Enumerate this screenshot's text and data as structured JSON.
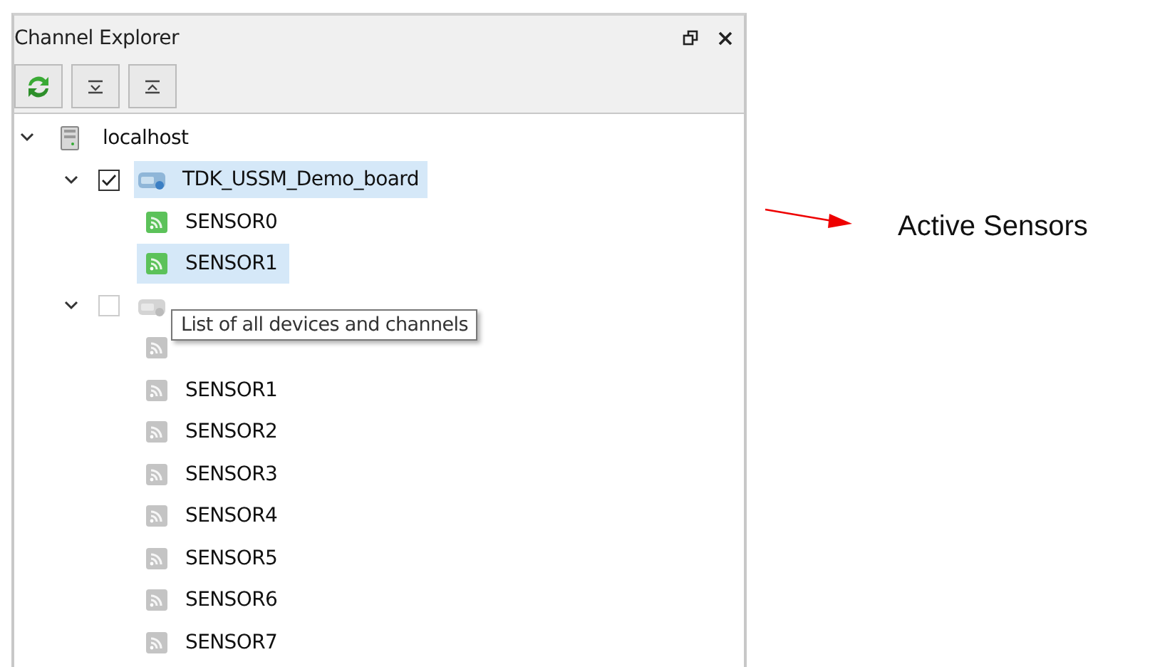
{
  "panel": {
    "title": "Channel Explorer",
    "toolbar": [
      {
        "kind": "refresh"
      },
      {
        "kind": "expand"
      },
      {
        "kind": "collapse"
      }
    ]
  },
  "tree": {
    "label": "localhost",
    "expanded": true,
    "children": [
      {
        "label": "TDK_USSM_Demo_board",
        "checked": true,
        "expanded": true,
        "selected": true,
        "active": true,
        "children": [
          {
            "label": "SENSOR0",
            "active": true,
            "selected": false
          },
          {
            "label": "SENSOR1",
            "active": true,
            "selected": true
          }
        ]
      },
      {
        "checked": false,
        "expanded": true,
        "selected": false,
        "active": false,
        "children": [
          {
            "active": false,
            "selected": false
          },
          {
            "label": "SENSOR1",
            "active": false,
            "selected": false
          },
          {
            "label": "SENSOR2",
            "active": false,
            "selected": false
          },
          {
            "label": "SENSOR3",
            "active": false,
            "selected": false
          },
          {
            "label": "SENSOR4",
            "active": false,
            "selected": false
          },
          {
            "label": "SENSOR5",
            "active": false,
            "selected": false
          },
          {
            "label": "SENSOR6",
            "active": false,
            "selected": false
          },
          {
            "label": "SENSOR7",
            "active": false,
            "selected": false
          }
        ]
      }
    ]
  },
  "tooltip": "List of all devices and channels",
  "annotation": {
    "label": "Active Sensors"
  }
}
